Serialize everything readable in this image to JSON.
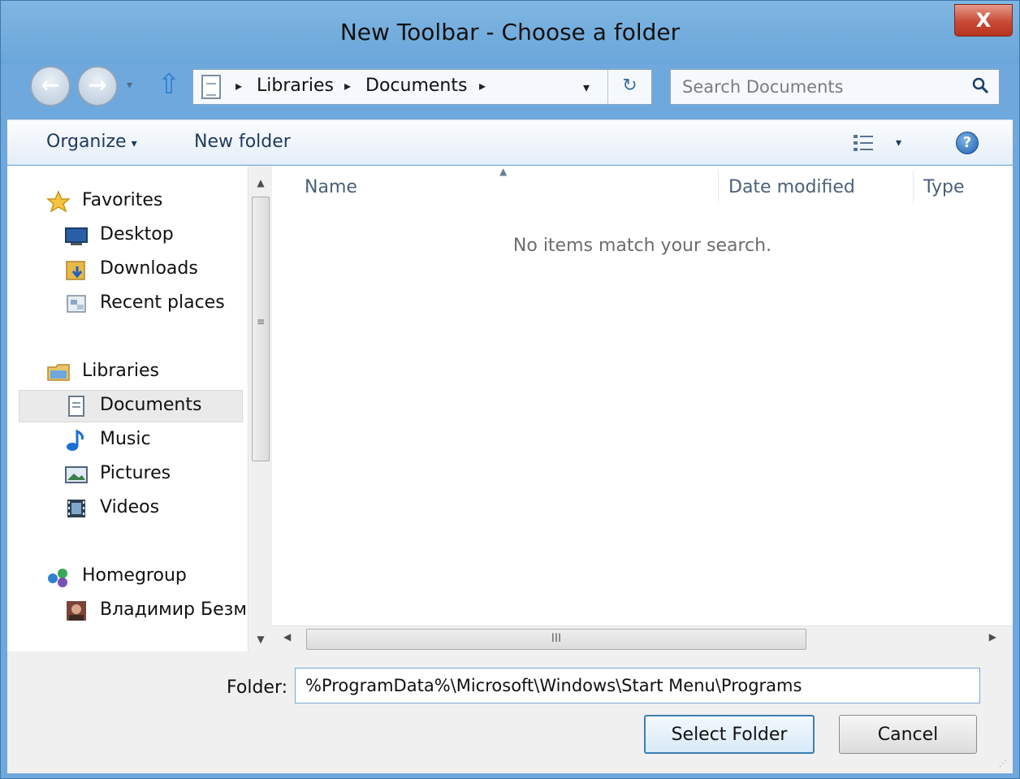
{
  "window": {
    "title": "New Toolbar - Choose a folder",
    "close_label": "X"
  },
  "nav": {
    "back_label": "←",
    "forward_label": "→",
    "history_caret": "▾",
    "up_label": "⇧",
    "breadcrumbs": [
      "Libraries",
      "Documents"
    ],
    "crumb_separator": "▸",
    "dropdown_caret": "▾",
    "refresh_label": "↻"
  },
  "search": {
    "placeholder": "Search Documents"
  },
  "toolbar": {
    "organize_label": "Organize",
    "organize_caret": "▾",
    "new_folder_label": "New folder",
    "view_caret": "▾",
    "help_label": "?"
  },
  "sidebar": {
    "groups": [
      {
        "label": "Favorites",
        "icon": "star-icon",
        "items": [
          {
            "label": "Desktop",
            "icon": "desktop-icon"
          },
          {
            "label": "Downloads",
            "icon": "downloads-icon"
          },
          {
            "label": "Recent places",
            "icon": "recent-places-icon"
          }
        ]
      },
      {
        "label": "Libraries",
        "icon": "libraries-icon",
        "items": [
          {
            "label": "Documents",
            "icon": "documents-icon",
            "selected": true
          },
          {
            "label": "Music",
            "icon": "music-icon"
          },
          {
            "label": "Pictures",
            "icon": "pictures-icon"
          },
          {
            "label": "Videos",
            "icon": "videos-icon"
          }
        ]
      },
      {
        "label": "Homegroup",
        "icon": "homegroup-icon",
        "items": [
          {
            "label": "Владимир Безма",
            "icon": "user-avatar-icon"
          }
        ]
      }
    ]
  },
  "file_list": {
    "columns": [
      "Name",
      "Date modified",
      "Type"
    ],
    "sort_indicator": "▲",
    "empty_message": "No items match your search."
  },
  "footer": {
    "folder_label": "Folder:",
    "folder_value": "%ProgramData%\\Microsoft\\Windows\\Start Menu\\Programs",
    "select_label": "Select Folder",
    "cancel_label": "Cancel"
  },
  "scroll": {
    "up": "▲",
    "down": "▼",
    "left": "◀",
    "right": "▶",
    "grip": "III"
  },
  "colors": {
    "frame": "#6fa8dc",
    "close": "#c64a36",
    "accent": "#3c7fb1"
  }
}
